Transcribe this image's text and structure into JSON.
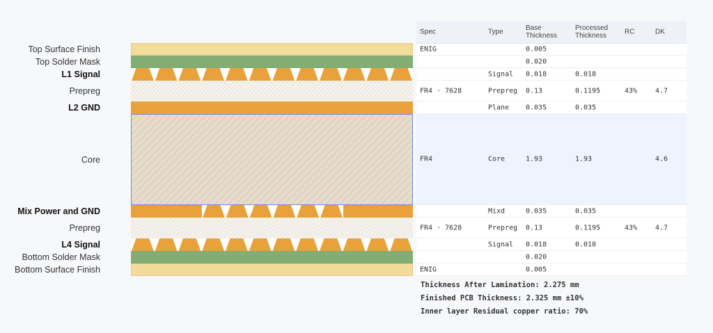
{
  "layers": [
    {
      "label": "Top Surface Finish",
      "bold": false,
      "kind": "finish",
      "spec": "ENIG",
      "type": "",
      "base": "0.005",
      "processed": "",
      "rc": "",
      "dk": ""
    },
    {
      "label": "Top Solder Mask",
      "bold": false,
      "kind": "mask",
      "spec": "",
      "type": "",
      "base": "0.020",
      "processed": "",
      "rc": "",
      "dk": ""
    },
    {
      "label": "L1 Signal",
      "bold": true,
      "kind": "signal",
      "spec": "",
      "type": "Signal",
      "base": "0.018",
      "processed": "0.018",
      "rc": "",
      "dk": ""
    },
    {
      "label": "Prepreg",
      "bold": false,
      "kind": "prepreg",
      "spec": "FR4 · 7628",
      "type": "Prepreg",
      "base": "0.13",
      "processed": "0.1195",
      "rc": "43%",
      "dk": "4.7"
    },
    {
      "label": "L2 GND",
      "bold": true,
      "kind": "plane",
      "spec": "",
      "type": "Plane",
      "base": "0.035",
      "processed": "0.035",
      "rc": "",
      "dk": ""
    },
    {
      "label": "Core",
      "bold": false,
      "kind": "core",
      "spec": "FR4",
      "type": "Core",
      "base": "1.93",
      "processed": "1.93",
      "rc": "",
      "dk": "4.6",
      "highlighted": true
    },
    {
      "label": "Mix Power and GND",
      "bold": true,
      "kind": "mixed",
      "spec": "",
      "type": "Mixd",
      "base": "0.035",
      "processed": "0.035",
      "rc": "",
      "dk": ""
    },
    {
      "label": "Prepreg",
      "bold": false,
      "kind": "prepreg",
      "spec": "FR4 · 7628",
      "type": "Prepreg",
      "base": "0.13",
      "processed": "0.1195",
      "rc": "43%",
      "dk": "4.7"
    },
    {
      "label": "L4 Signal",
      "bold": true,
      "kind": "signal",
      "spec": "",
      "type": "Signal",
      "base": "0.018",
      "processed": "0.018",
      "rc": "",
      "dk": ""
    },
    {
      "label": "Bottom Solder Mask",
      "bold": false,
      "kind": "mask",
      "spec": "",
      "type": "",
      "base": "0.020",
      "processed": "",
      "rc": "",
      "dk": ""
    },
    {
      "label": "Bottom Surface Finish",
      "bold": false,
      "kind": "finish",
      "spec": "ENIG",
      "type": "",
      "base": "0.005",
      "processed": "",
      "rc": "",
      "dk": ""
    }
  ],
  "table_headers": {
    "spec": "Spec",
    "type": "Type",
    "base": "Base Thickness",
    "processed": "Processed Thickness",
    "rc": "RC",
    "dk": "DK"
  },
  "summary": {
    "lamination": "Thickness After Lamination: 2.275 mm",
    "finished": "Finished PCB Thickness: 2.325 mm ±10%",
    "residual": "Inner layer Residual copper ratio: 70%"
  },
  "colors": {
    "finish": "#f3dc9a",
    "mask": "#82ad74",
    "copper": "#e8a13b",
    "prepreg": "#f6f4ef",
    "core": "#e6dccb",
    "core_border": "#6b8fd6",
    "highlight": "#eef4fd"
  }
}
